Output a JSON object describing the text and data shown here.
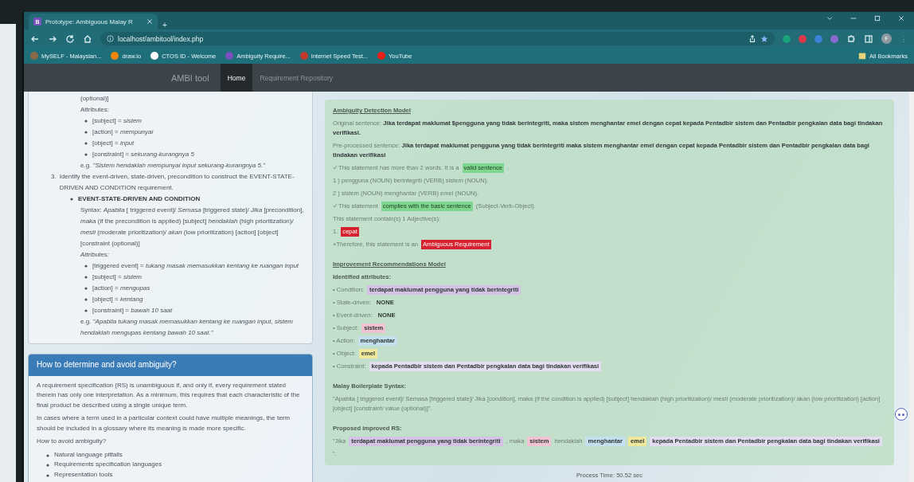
{
  "browser": {
    "tabs": [
      {
        "icon": "B",
        "title": "Prototype: Ambiguous Malay R",
        "selected": true
      }
    ],
    "new_tab": "+",
    "address": "localhost/ambitool/index.php",
    "bookmarks": [
      {
        "label": "MySELF - Malaysian...",
        "color": "#8a6a4a"
      },
      {
        "label": "draw.io",
        "color": "#f08705"
      },
      {
        "label": "CTOS ID - Welcome",
        "color": "#ffffff"
      },
      {
        "label": "Ambiguity Require...",
        "color": "#7a4fc0"
      },
      {
        "label": "Internet Speed Test...",
        "color": "#c0392b"
      },
      {
        "label": "YouTube",
        "color": "#e62117"
      }
    ],
    "all_bookmarks": "All Bookmarks",
    "profile": "F"
  },
  "navbar": {
    "brand": "AMBI tool",
    "links": [
      {
        "label": "Home",
        "selected": true
      },
      {
        "label": "Requirement Repository",
        "selected": false
      }
    ]
  },
  "guide_card": {
    "fragment": "(optional)]",
    "attributes_label": "Attributes:",
    "attributes": [
      "[subject] = *sistem*",
      "[action] = *mempunyai*",
      "[object] = *input*",
      "[constraint] = *sekurang-kurangnya 5*"
    ],
    "example": "e.g. *\"Sistem hendaklah mempunyai input sekurang-kurangnya 5.\"*",
    "step": {
      "number": "3.",
      "text": "Identify the event-driven, state-driven, precondition to construct the EVENT-STATE-DRIVEN AND CONDITION requirement.",
      "children": [
        {
          "heading": "EVENT-STATE-DRIVEN AND CONDITION",
          "syntax": "Syntax: *Apabila* [ triggered event]/ *Semasa* [triggered state]/ *Jika* [precondition], *maka* (if the precondition is applied) [subject] *hendaklah* (high prioritization)/ *mesti* (moderate prioritization)/ *akan* (low prioritization) [action] [object] [constraint (optional)]",
          "attributes_label": "Attributes:",
          "attributes": [
            "[triggered event] = *tukang masak memasukkan kentang ke ruangan input*",
            "[subject] = *sistem*",
            "[action] = *mengupas*",
            "[object] = *kentang*",
            "[constraint] = *bawah 10 saat*"
          ],
          "example": "e.g. *\"Apabila tukang masak memasukkan kentang ke ruangan input, sistem hendaklah mengupas kentang bawah 10 saat.\"*"
        }
      ]
    }
  },
  "ambiguity_panel": {
    "title": "How to determine and avoid ambiguity?",
    "paragraphs": [
      "A requirement specification (RS) is unambiguous if, and only if, every requirement stated therein has only one interpretation. As a minimum, this requires that each characteristic of the final product be described using a single unique term.",
      "In cases where a term used in a particular context could have multiple meanings, the term should be included in a glossary where its meaning is made more specific.",
      "How to avoid ambiguity?"
    ],
    "items": [
      "Natural language pitfalls",
      "Requirements specification languages",
      "Representation tools"
    ]
  },
  "detection": {
    "title": "Ambiguity Detection Model",
    "original": {
      "label": "Original sentence:",
      "value": "Jika terdapat maklumat $pengguna yang tidak berintegriti, maka sistem menghantar emel dengan cepat kepada Pentadbir sistem dan Pentadbir pengkalan data bagi tindakan verifikasi."
    },
    "preprocessed": {
      "label": "Pre-processed sentence:",
      "value": "Jika terdapat maklumat pengguna yang tidak berintegriti maka sistem menghantar emel dengan cepat kepada Pentadbir sistem dan Pentadbir pengkalan data bagi tindakan verifikasi"
    },
    "lines": [
      [
        {
          "kind": "plain",
          "text": "✓This statement has more than 2 words. It is a"
        },
        {
          "kind": "success",
          "text": "valid sentence"
        },
        {
          "kind": "plain",
          "text": "."
        }
      ],
      [
        {
          "kind": "plain",
          "text": "1 ) pengguna (NOUN) berintegriti (VERB) sistem (NOUN)."
        }
      ],
      [
        {
          "kind": "plain",
          "text": "2 ) sistem (NOUN) menghantar (VERB) emel (NOUN)."
        }
      ],
      [
        {
          "kind": "plain",
          "text": "✓This statement"
        },
        {
          "kind": "success",
          "text": "complies with the basic sentence"
        },
        {
          "kind": "plain",
          "text": "(Subject-Verb-Object)."
        }
      ],
      [
        {
          "kind": "plain",
          "text": "This statement contain(s) 1 Adjective(s):"
        }
      ],
      [
        {
          "kind": "plain",
          "text": "1."
        },
        {
          "kind": "danger",
          "text": "cepat"
        }
      ],
      [
        {
          "kind": "plain",
          "text": "×Therefore, this statement is an"
        },
        {
          "kind": "danger",
          "text": "Ambiguous Requirement"
        }
      ]
    ]
  },
  "improvement": {
    "title": "Improvement Recommendations Model",
    "attributes_title": "Identified attributes:",
    "attributes": [
      {
        "label": "• Condition:",
        "value": "terdapat maklumat pengguna yang tidak berintegriti",
        "color": "#d5c3e6"
      },
      {
        "label": "• State-driven:",
        "value": "NONE"
      },
      {
        "label": "• Event-driven:",
        "value": "NONE"
      },
      {
        "label": "• Subject:",
        "value": "sistem",
        "color": "#efc3d3"
      },
      {
        "label": "• Action:",
        "value": "menghantar",
        "color": "#c4e0ee"
      },
      {
        "label": "• Object:",
        "value": "emel",
        "color": "#eee79c"
      },
      {
        "label": "• Constraint:",
        "value": "kepada Pentadbir sistem dan Pentadbir pengkalan data bagi tindakan verifikasi",
        "color": "#e3dcf0"
      }
    ],
    "syntax_title": "Malay Boilerplate Syntax:",
    "syntax": "\"Apabila [ triggered event]/ Semasa [triggered state]/ Jika [condition], maka (if the condition is applied) [subject] hendaklah (high prioritization)/ mesti (moderate prioritization)/ akan (low prioritization) [action] [object] [constraint/ value (optional)]\".",
    "proposed_title": "Proposed improved RS:",
    "proposed": [
      {
        "text": "\"Jika"
      },
      {
        "text": "terdapat maklumat pengguna yang tidak berintegriti",
        "color": "#d5c3e6"
      },
      {
        "text": ", maka"
      },
      {
        "text": "sistem",
        "color": "#efc3d3"
      },
      {
        "text": "hendaklah"
      },
      {
        "text": "menghantar",
        "color": "#c4e0ee"
      },
      {
        "text": "emel",
        "color": "#eee79c"
      },
      {
        "text": "kepada Pentadbir sistem dan Pentadbir pengkalan data bagi tindakan verifikasi",
        "color": "#e3dcf0"
      },
      {
        "text": "\"."
      }
    ]
  },
  "process_time": "Process Time: 50.52 sec"
}
